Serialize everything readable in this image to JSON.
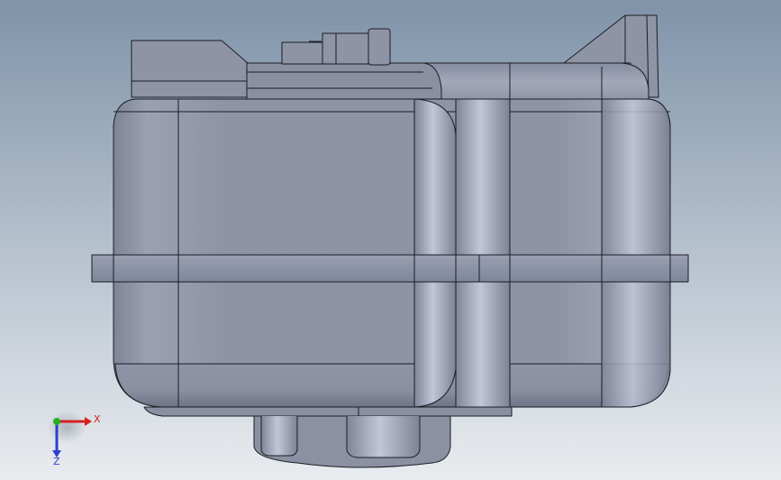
{
  "viewport": {
    "background_top": "#7f93a9",
    "background_bottom": "#e9ecef",
    "model_color": "#8e94a6",
    "model_highlight": "#b9bfd2",
    "model_shadow": "#6f7486",
    "edge_color": "#1b1d24"
  },
  "triad": {
    "x_label": "X",
    "z_label": "Z",
    "x_color": "#d62020",
    "y_color": "#22b022",
    "z_color": "#2a3fd0"
  }
}
